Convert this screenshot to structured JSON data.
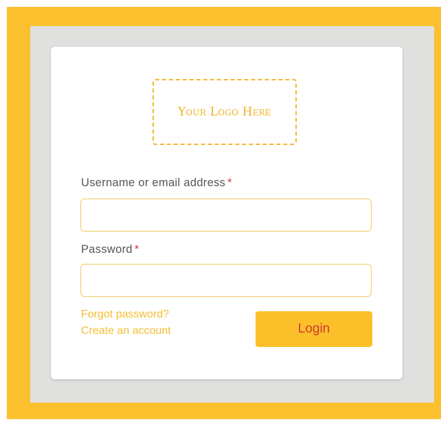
{
  "logo": {
    "text": "Your Logo Here"
  },
  "form": {
    "username": {
      "label": "Username or email address",
      "required_mark": "*",
      "value": "",
      "placeholder": ""
    },
    "password": {
      "label": "Password",
      "required_mark": "*",
      "value": "",
      "placeholder": ""
    }
  },
  "links": {
    "forgot_password": "Forgot password?",
    "create_account": "Create an account"
  },
  "actions": {
    "login_label": "Login"
  },
  "colors": {
    "accent": "#fbc02d",
    "link": "#f5bd30",
    "button_text": "#d23b30",
    "required": "#d9323a",
    "panel": "#e0e0df"
  }
}
